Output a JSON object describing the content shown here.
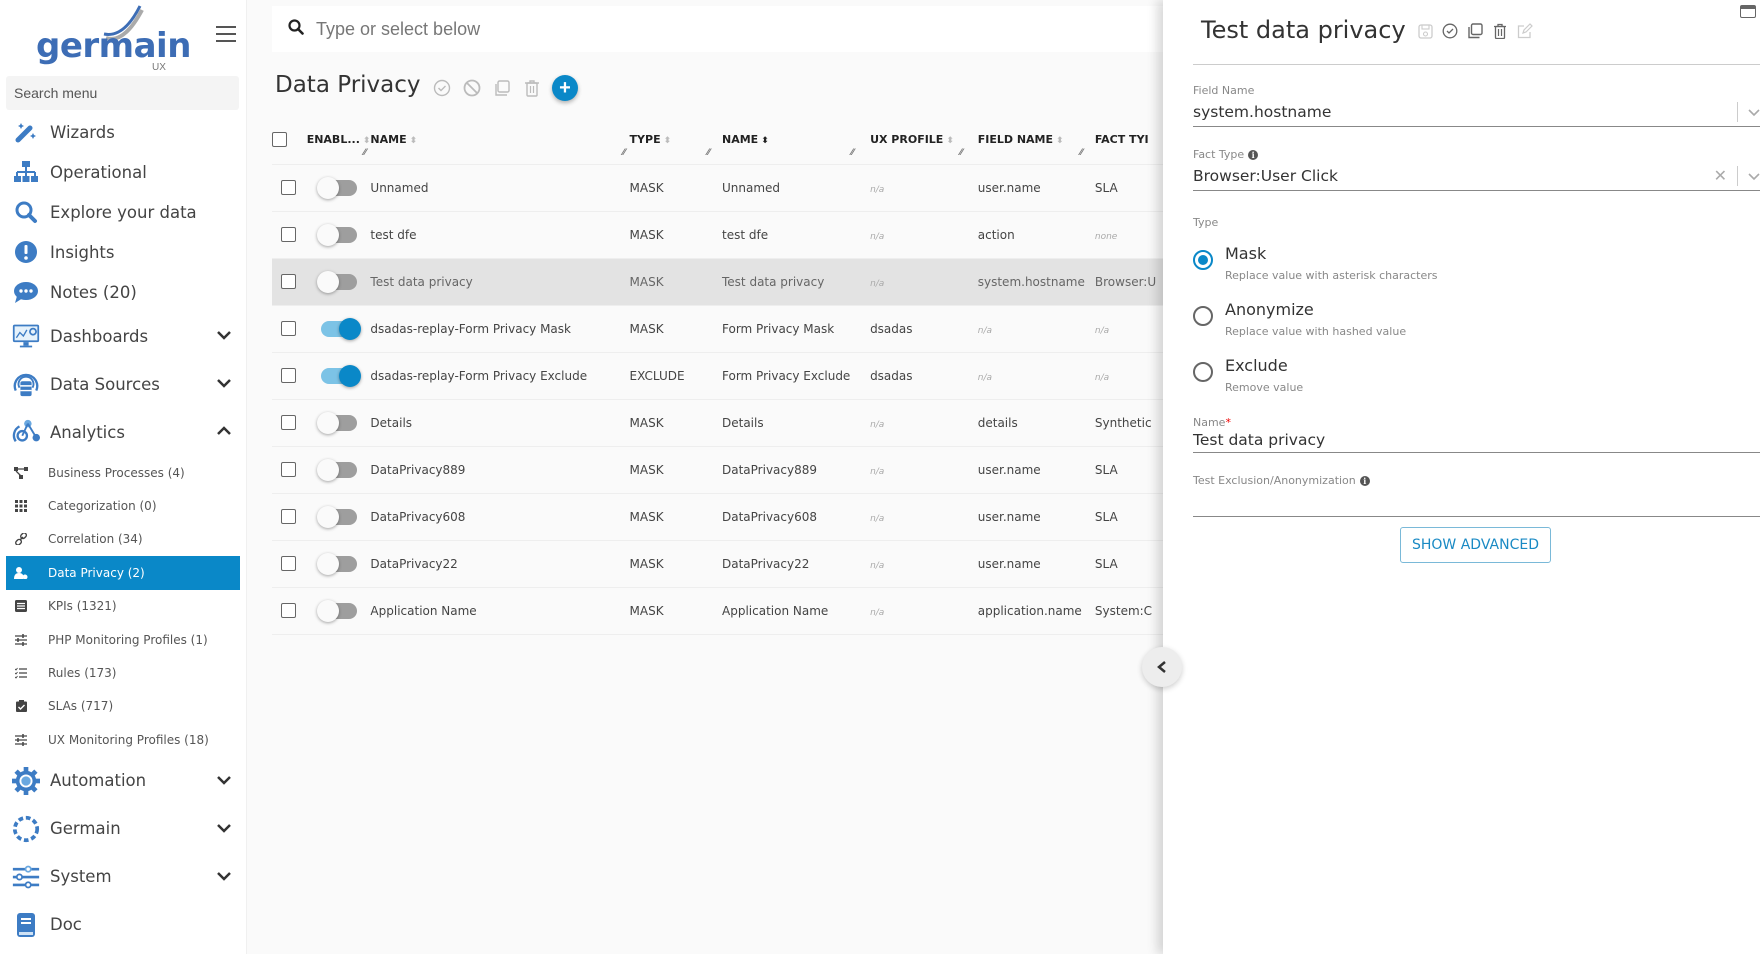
{
  "brand": {
    "name": "germain",
    "sub": "UX",
    "accent": "#0a88c8"
  },
  "sidebar": {
    "search_placeholder": "Search menu",
    "items": [
      {
        "label": "Wizards",
        "icon": "magic-wand-icon"
      },
      {
        "label": "Operational",
        "icon": "sitemap-icon"
      },
      {
        "label": "Explore your data",
        "icon": "search-icon"
      },
      {
        "label": "Insights",
        "icon": "exclamation-circle-icon"
      },
      {
        "label": "Notes (20)",
        "icon": "comment-dots-icon"
      },
      {
        "label": "Dashboards",
        "icon": "monitor-chart-icon",
        "expandable": true,
        "expanded": false
      },
      {
        "label": "Data Sources",
        "icon": "database-icon",
        "expandable": true,
        "expanded": false
      },
      {
        "label": "Analytics",
        "icon": "analytics-icon",
        "expandable": true,
        "expanded": true
      }
    ],
    "analytics_sub": [
      {
        "label": "Business Processes (4)",
        "icon": "process-icon"
      },
      {
        "label": "Categorization (0)",
        "icon": "grid-icon"
      },
      {
        "label": "Correlation (34)",
        "icon": "link-icon"
      },
      {
        "label": "Data Privacy (2)",
        "icon": "user-lock-icon",
        "active": true
      },
      {
        "label": "KPIs (1321)",
        "icon": "list-box-icon"
      },
      {
        "label": "PHP Monitoring Profiles (1)",
        "icon": "sliders-icon"
      },
      {
        "label": "Rules (173)",
        "icon": "checklist-icon"
      },
      {
        "label": "SLAs (717)",
        "icon": "clipboard-check-icon"
      },
      {
        "label": "UX Monitoring Profiles (18)",
        "icon": "sliders-icon"
      }
    ],
    "bottom_items": [
      {
        "label": "Automation",
        "icon": "gear-icon",
        "expandable": true
      },
      {
        "label": "Germain",
        "icon": "germain-ring-icon",
        "expandable": true
      },
      {
        "label": "System",
        "icon": "settings-sliders-icon",
        "expandable": true
      },
      {
        "label": "Doc",
        "icon": "book-icon"
      }
    ]
  },
  "main": {
    "search_placeholder": "Type or select below",
    "title": "Data Privacy",
    "columns": [
      "ENABL...",
      "NAME",
      "TYPE",
      "NAME",
      "UX PROFILE",
      "FIELD NAME",
      "FACT TYI"
    ],
    "rows": [
      {
        "enabled": false,
        "name": "Unnamed",
        "type": "MASK",
        "name2": "Unnamed",
        "ux_profile": "n/a",
        "field_name": "user.name",
        "fact_type": "SLA"
      },
      {
        "enabled": false,
        "name": "test dfe",
        "type": "MASK",
        "name2": "test dfe",
        "ux_profile": "n/a",
        "field_name": "action",
        "fact_type": "none"
      },
      {
        "enabled": false,
        "name": "Test data privacy",
        "type": "MASK",
        "name2": "Test data privacy",
        "ux_profile": "n/a",
        "field_name": "system.hostname",
        "fact_type": "Browser:U",
        "selected": true
      },
      {
        "enabled": true,
        "name": "dsadas-replay-Form Privacy Mask",
        "type": "MASK",
        "name2": "Form Privacy Mask",
        "ux_profile": "dsadas",
        "field_name": "n/a",
        "fact_type": "n/a"
      },
      {
        "enabled": true,
        "name": "dsadas-replay-Form Privacy Exclude",
        "type": "EXCLUDE",
        "name2": "Form Privacy Exclude",
        "ux_profile": "dsadas",
        "field_name": "n/a",
        "fact_type": "n/a"
      },
      {
        "enabled": false,
        "name": "Details",
        "type": "MASK",
        "name2": "Details",
        "ux_profile": "n/a",
        "field_name": "details",
        "fact_type": "Synthetic"
      },
      {
        "enabled": false,
        "name": "DataPrivacy889",
        "type": "MASK",
        "name2": "DataPrivacy889",
        "ux_profile": "n/a",
        "field_name": "user.name",
        "fact_type": "SLA"
      },
      {
        "enabled": false,
        "name": "DataPrivacy608",
        "type": "MASK",
        "name2": "DataPrivacy608",
        "ux_profile": "n/a",
        "field_name": "user.name",
        "fact_type": "SLA"
      },
      {
        "enabled": false,
        "name": "DataPrivacy22",
        "type": "MASK",
        "name2": "DataPrivacy22",
        "ux_profile": "n/a",
        "field_name": "user.name",
        "fact_type": "SLA"
      },
      {
        "enabled": false,
        "name": "Application Name",
        "type": "MASK",
        "name2": "Application Name",
        "ux_profile": "n/a",
        "field_name": "application.name",
        "fact_type": "System:C"
      }
    ]
  },
  "panel": {
    "title": "Test data privacy",
    "field_name_label": "Field Name",
    "field_name_value": "system.hostname",
    "fact_type_label": "Fact Type",
    "fact_type_value": "Browser:User Click",
    "type_label": "Type",
    "type_options": [
      {
        "title": "Mask",
        "desc": "Replace value with asterisk characters",
        "selected": true
      },
      {
        "title": "Anonymize",
        "desc": "Replace value with hashed value",
        "selected": false
      },
      {
        "title": "Exclude",
        "desc": "Remove value",
        "selected": false
      }
    ],
    "name_label": "Name",
    "name_required": "*",
    "name_value": "Test data privacy",
    "test_label": "Test Exclusion/Anonymization",
    "test_value": "",
    "show_advanced": "SHOW ADVANCED"
  }
}
